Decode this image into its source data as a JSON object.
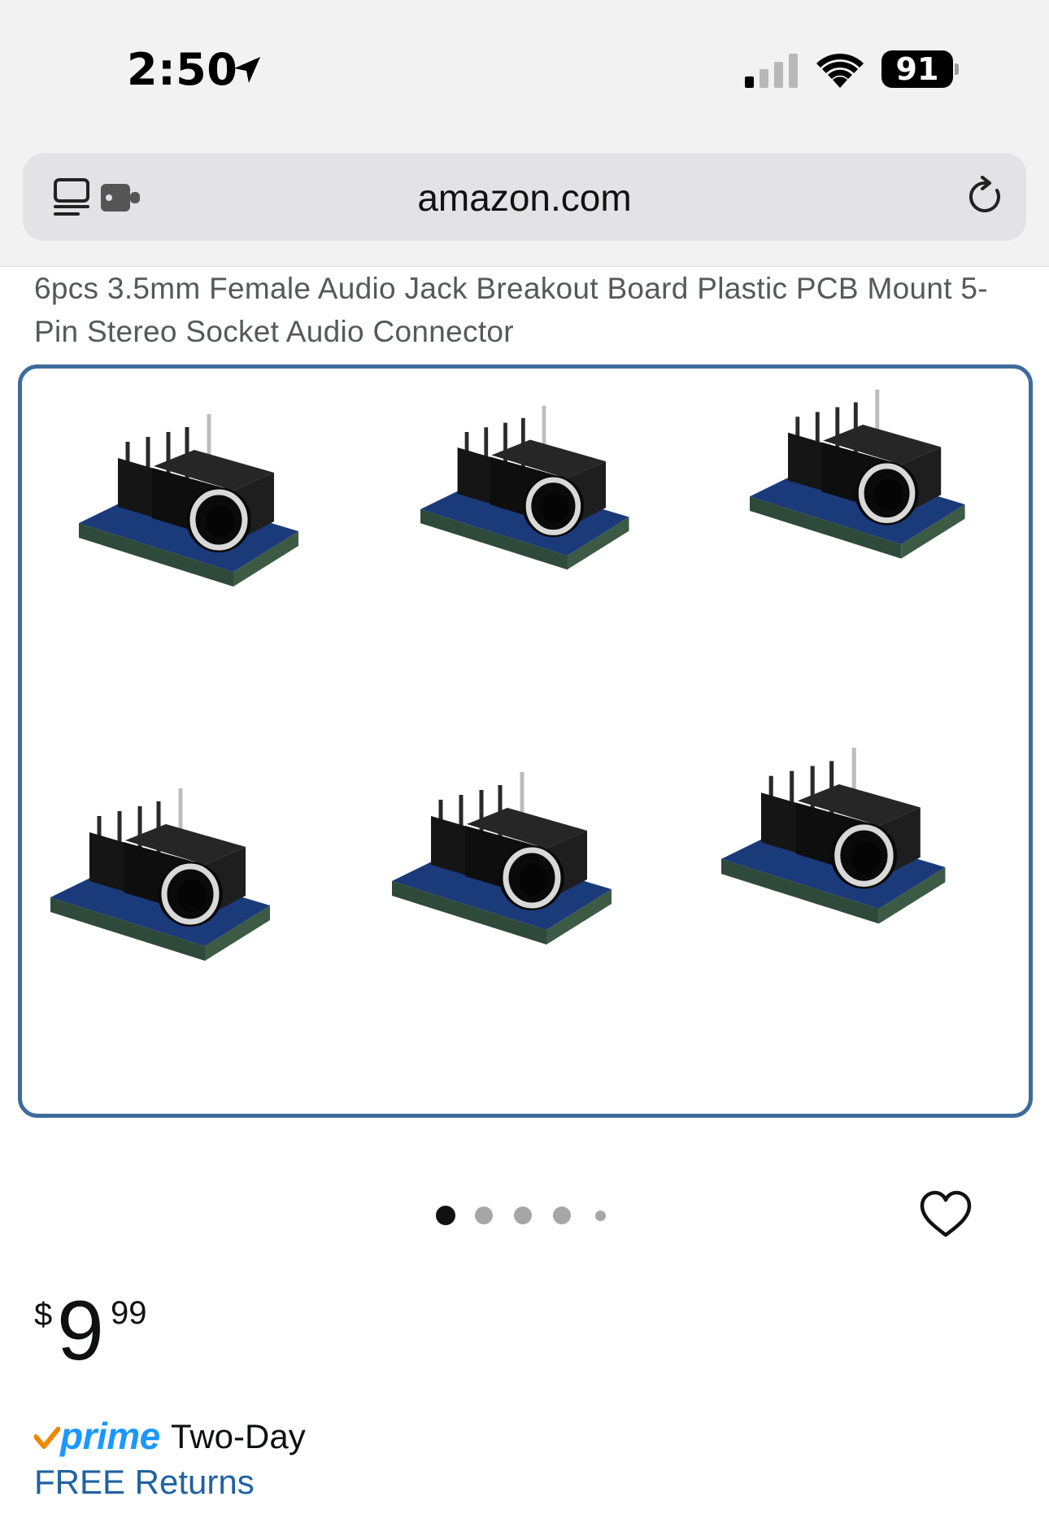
{
  "status_bar": {
    "time": "2:50",
    "battery": "91",
    "icons": [
      "location-arrow-icon",
      "cellular-signal-icon",
      "wifi-icon",
      "battery-icon"
    ]
  },
  "browser": {
    "url": "amazon.com",
    "icons": [
      "tab-overview-icon",
      "extension-icon",
      "reload-icon"
    ]
  },
  "product": {
    "title": "6pcs 3.5mm Female Audio Jack Breakout Board Plastic PCB Mount 5-Pin Stereo Socket Audio Connector",
    "image_alt": "Six 3.5mm audio jack breakout boards",
    "carousel": {
      "total_dots": 5,
      "active_index": 0
    },
    "price": {
      "symbol": "$",
      "whole": "9",
      "fraction": "99"
    },
    "shipping": {
      "prime_label": "prime",
      "speed": "Two-Day",
      "returns": "FREE Returns"
    },
    "colors": {
      "frame_border": "#3f6b9b",
      "prime_blue": "#1a98ff",
      "prime_check": "#f08804",
      "link": "#2162a1"
    }
  }
}
